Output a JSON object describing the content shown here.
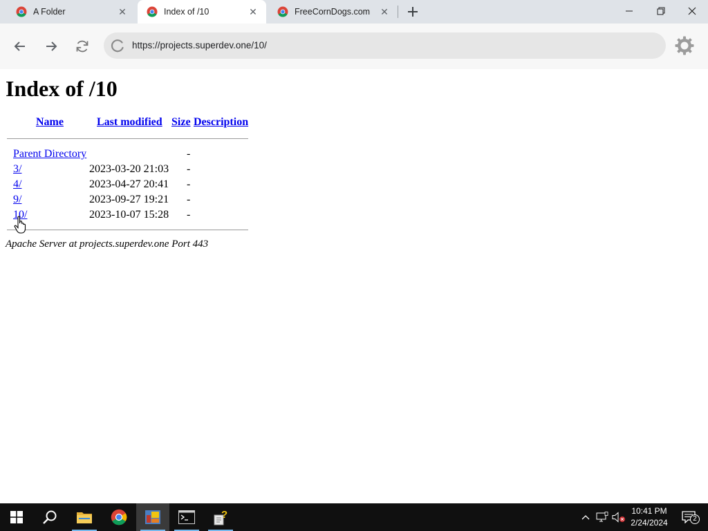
{
  "browser": {
    "tabs": [
      {
        "title": "A Folder",
        "icon": "chrome-icon",
        "active": false
      },
      {
        "title": "Index of /10",
        "icon": "chrome-icon",
        "active": true
      },
      {
        "title": "FreeCornDogs.com",
        "icon": "chrome-icon",
        "active": false
      }
    ],
    "new_tab_icon": "plus-icon",
    "window_controls": [
      "minimize-icon",
      "restore-icon",
      "close-icon"
    ],
    "nav": {
      "back_icon": "arrow-left-icon",
      "forward_icon": "arrow-right-icon",
      "reload_icon": "reload-icon"
    },
    "address_bar": {
      "url": "https://projects.superdev.one/10/",
      "loading": true
    },
    "settings_icon": "gear-icon"
  },
  "page": {
    "title": "Index of /10",
    "columns": [
      "Name",
      "Last modified",
      "Size",
      "Description"
    ],
    "rows": [
      {
        "name": "Parent Directory",
        "modified": "",
        "size": "-",
        "description": ""
      },
      {
        "name": "3/",
        "modified": "2023-03-20 21:03",
        "size": "-",
        "description": ""
      },
      {
        "name": "4/",
        "modified": "2023-04-27 20:41",
        "size": "-",
        "description": ""
      },
      {
        "name": "9/",
        "modified": "2023-09-27 19:21",
        "size": "-",
        "description": ""
      },
      {
        "name": "10/",
        "modified": "2023-10-07 15:28",
        "size": "-",
        "description": ""
      }
    ],
    "server_signature": "Apache Server at projects.superdev.one Port 443"
  },
  "taskbar": {
    "apps": [
      "windows-start-icon",
      "search-icon",
      "file-explorer-icon",
      "chrome-icon",
      "image-app-icon",
      "terminal-icon",
      "help-tool-icon"
    ],
    "tray": {
      "icons": [
        "chevron-up-icon",
        "network-icon",
        "volume-muted-icon"
      ],
      "time": "10:41 PM",
      "date": "2/24/2024",
      "notifications": "2"
    }
  },
  "colors": {
    "tabstrip": "#dfe3e8",
    "toolbar": "#f7f7f7",
    "link": "#0000ee",
    "taskbar": "#101010",
    "running_indicator": "#76b9ed"
  }
}
